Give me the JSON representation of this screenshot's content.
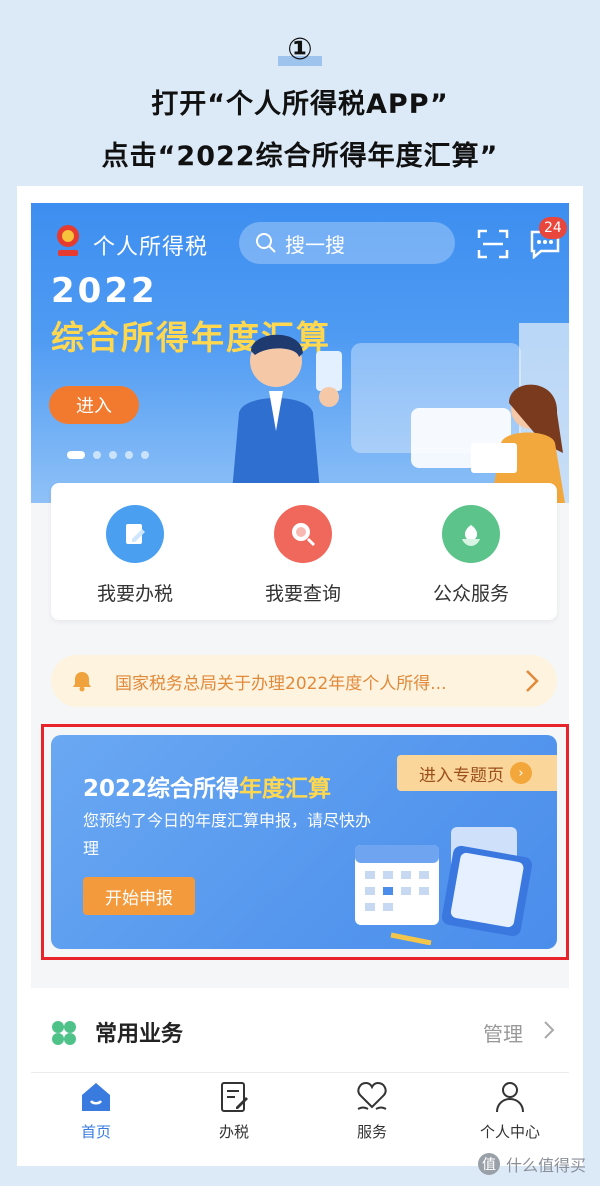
{
  "instructions": {
    "step": "①",
    "line1": "打开“个人所得税APP”",
    "line2": "点击“2022综合所得年度汇算”"
  },
  "header": {
    "app_title": "个人所得税",
    "search_placeholder": "搜一搜",
    "message_count": "24"
  },
  "banner": {
    "year": "2022",
    "title": "综合所得年度汇算",
    "enter_label": "进入",
    "slide_count": 5,
    "active_slide": 1
  },
  "services": [
    {
      "label": "我要办税",
      "icon": "pencil-doc-icon",
      "color": "#4a9ff0"
    },
    {
      "label": "我要查询",
      "icon": "magnifier-icon",
      "color": "#f0675c"
    },
    {
      "label": "公众服务",
      "icon": "tulip-icon",
      "color": "#5cc48a"
    }
  ],
  "notice": {
    "text": "国家税务总局关于办理2022年度个人所得..."
  },
  "annual_card": {
    "title_prefix": "2022综合所得",
    "title_highlight": "年度汇算",
    "description": "您预约了今日的年度汇算申报，请尽快办理",
    "start_label": "开始申报",
    "topic_label": "进入专题页"
  },
  "common": {
    "title": "常用业务",
    "manage_label": "管理"
  },
  "tabbar": [
    {
      "label": "首页",
      "icon": "home-icon",
      "active": true
    },
    {
      "label": "办税",
      "icon": "doc-edit-icon",
      "active": false
    },
    {
      "label": "服务",
      "icon": "heart-service-icon",
      "active": false
    },
    {
      "label": "个人中心",
      "icon": "person-icon",
      "active": false
    }
  ],
  "watermark": {
    "symbol": "值",
    "text": "什么值得买"
  },
  "colors": {
    "page_bg": "#dceaf8",
    "banner_blue": "#3d8ef0",
    "accent_orange": "#f27a2e",
    "highlight_yellow": "#ffd84f",
    "frame_red": "#e8232a",
    "active_tab": "#3a7be0"
  }
}
